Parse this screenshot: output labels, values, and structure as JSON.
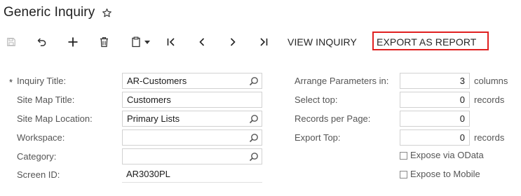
{
  "header": {
    "title": "Generic Inquiry",
    "favorite_icon": "star-outline-icon"
  },
  "toolbar": {
    "buttons": [
      {
        "name": "save",
        "icon": "save-icon",
        "enabled": false
      },
      {
        "name": "undo",
        "icon": "undo-icon",
        "enabled": true
      },
      {
        "name": "add",
        "icon": "plus-icon",
        "enabled": true
      },
      {
        "name": "delete",
        "icon": "trash-icon",
        "enabled": true
      },
      {
        "name": "copy-paste",
        "icon": "clipboard-icon",
        "enabled": true
      },
      {
        "name": "first",
        "icon": "first-record-icon",
        "enabled": true
      },
      {
        "name": "previous",
        "icon": "previous-record-icon",
        "enabled": true
      },
      {
        "name": "next",
        "icon": "next-record-icon",
        "enabled": true
      },
      {
        "name": "last",
        "icon": "last-record-icon",
        "enabled": true
      }
    ],
    "view_inquiry_label": "VIEW INQUIRY",
    "export_as_report_label": "EXPORT AS REPORT"
  },
  "form": {
    "inquiry_title": {
      "label": "Inquiry Title:",
      "value": "AR-Customers",
      "required_marker": "*"
    },
    "site_map_title": {
      "label": "Site Map Title:",
      "value": "Customers"
    },
    "site_map_location": {
      "label": "Site Map Location:",
      "value": "Primary Lists"
    },
    "workspace": {
      "label": "Workspace:",
      "value": ""
    },
    "category": {
      "label": "Category:",
      "value": ""
    },
    "screen_id": {
      "label": "Screen ID:",
      "value": "AR3030PL"
    },
    "arrange_parameters": {
      "label": "Arrange Parameters in:",
      "value": "3",
      "unit": "columns"
    },
    "select_top": {
      "label": "Select top:",
      "value": "0",
      "unit": "records"
    },
    "records_per_page": {
      "label": "Records per Page:",
      "value": "0"
    },
    "export_top": {
      "label": "Export Top:",
      "value": "0",
      "unit": "records"
    },
    "expose_odata": {
      "label": "Expose via OData",
      "checked": false
    },
    "expose_mobile": {
      "label": "Expose to Mobile",
      "checked": false
    }
  },
  "colors": {
    "highlight": "#e02020",
    "field_border": "#d1d1d1",
    "label_text": "#555555"
  }
}
